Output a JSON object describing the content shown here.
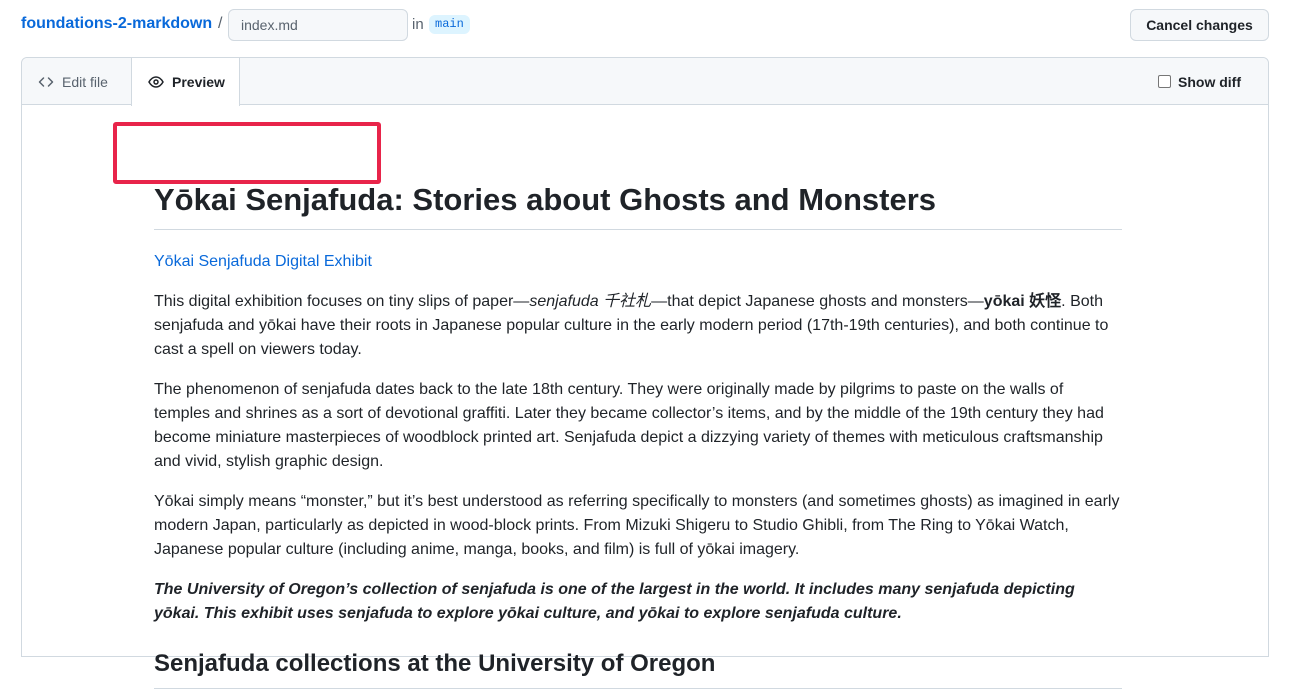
{
  "header": {
    "repo_name": "foundations-2-markdown",
    "separator": "/",
    "filename_value": "index.md",
    "in_label": "in",
    "branch": "main",
    "cancel_label": "Cancel changes"
  },
  "tabs": {
    "edit_label": "Edit file",
    "preview_label": "Preview",
    "show_diff_label": "Show diff",
    "active": "Preview"
  },
  "preview": {
    "title": "Yōkai Senjafuda: Stories about Ghosts and Monsters",
    "exhibit_link": "Yōkai Senjafuda Digital Exhibit",
    "p1_a": "This digital exhibition focuses on tiny slips of paper—",
    "p1_em": "senjafuda 千社札",
    "p1_b": "—that depict Japanese ghosts and monsters—",
    "p1_strong": "yōkai 妖怪",
    "p1_c": ". Both senjafuda and yōkai have their roots in Japanese popular culture in the early modern period (17th-19th centuries), and both continue to cast a spell on viewers today.",
    "p2": "The phenomenon of senjafuda dates back to the late 18th century. They were originally made by pilgrims to paste on the walls of temples and shrines as a sort of devotional graffiti. Later they became collector’s items, and by the middle of the 19th century they had become miniature masterpieces of woodblock printed art. Senjafuda depict a dizzying variety of themes with meticulous craftsmanship and vivid, stylish graphic design.",
    "p3": "Yōkai simply means “monster,” but it’s best understood as referring specifically to monsters (and sometimes ghosts) as imagined in early modern Japan, particularly as depicted in wood-block prints. From Mizuki Shigeru to Studio Ghibli, from The Ring to Yōkai Watch, Japanese popular culture (including anime, manga, books, and film) is full of yōkai imagery.",
    "p4": "The University of Oregon’s collection of senjafuda is one of the largest in the world. It includes many senjafuda depicting yōkai. This exhibit uses senjafuda to explore yōkai culture, and yōkai to explore senjafuda culture.",
    "subheading": "Senjafuda collections at the University of Oregon"
  },
  "colors": {
    "link": "#0969da",
    "highlight": "#e8244a",
    "branch_bg": "#ddf4ff"
  }
}
